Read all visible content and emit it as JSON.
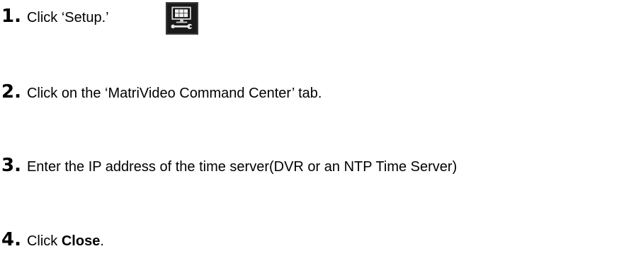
{
  "steps": [
    {
      "number": "1.",
      "text": "Click ‘Setup.’"
    },
    {
      "number": "2.",
      "text": "Click on the ‘MatriVideo Command Center’ tab."
    },
    {
      "number": "3.",
      "text": "Enter the IP address of the time server(DVR or an NTP Time Server)"
    },
    {
      "number": "4.",
      "text_prefix": "Click ",
      "text_bold": "Close",
      "text_suffix": "."
    }
  ],
  "icons": {
    "setup": "setup-monitor-wrench-icon"
  }
}
